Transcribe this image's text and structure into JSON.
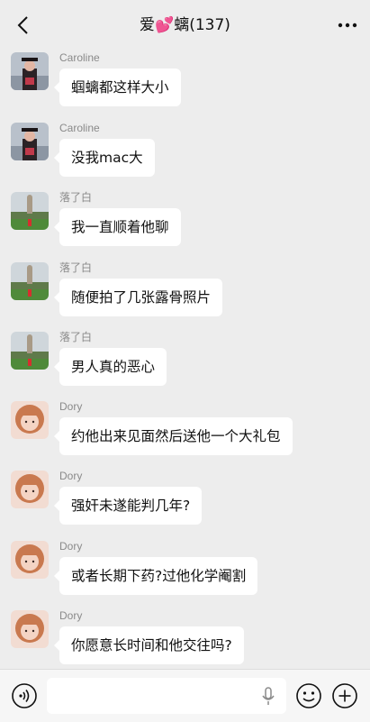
{
  "header": {
    "title": "爱💕螭(137)",
    "back_icon": "chevron-left-icon",
    "more_icon": "more-dots-icon"
  },
  "messages": [
    {
      "sender": "Caroline",
      "text": "蝈螭都这样大小",
      "avatar": "graduate"
    },
    {
      "sender": "Caroline",
      "text": "没我mac大",
      "avatar": "graduate"
    },
    {
      "sender": "落了白",
      "text": "我一直顺着他聊",
      "avatar": "statue"
    },
    {
      "sender": "落了白",
      "text": "随便拍了几张露骨照片",
      "avatar": "statue"
    },
    {
      "sender": "落了白",
      "text": "男人真的恶心",
      "avatar": "statue"
    },
    {
      "sender": "Dory",
      "text": "约他出来见面然后送他一个大礼包",
      "avatar": "girl"
    },
    {
      "sender": "Dory",
      "text": "强奸未遂能判几年?",
      "avatar": "girl"
    },
    {
      "sender": "Dory",
      "text": "或者长期下药?过他化学阉割",
      "avatar": "girl"
    },
    {
      "sender": "Dory",
      "text": "你愿意长时间和他交往吗?",
      "avatar": "girl"
    }
  ],
  "input_bar": {
    "placeholder": "",
    "value": "",
    "icons": [
      "voice-icon",
      "microphone-icon",
      "emoji-icon",
      "plus-icon"
    ]
  },
  "colors": {
    "background": "#ededed",
    "bubble": "#ffffff",
    "sender_name": "#8a8a8a",
    "text": "#111111"
  }
}
